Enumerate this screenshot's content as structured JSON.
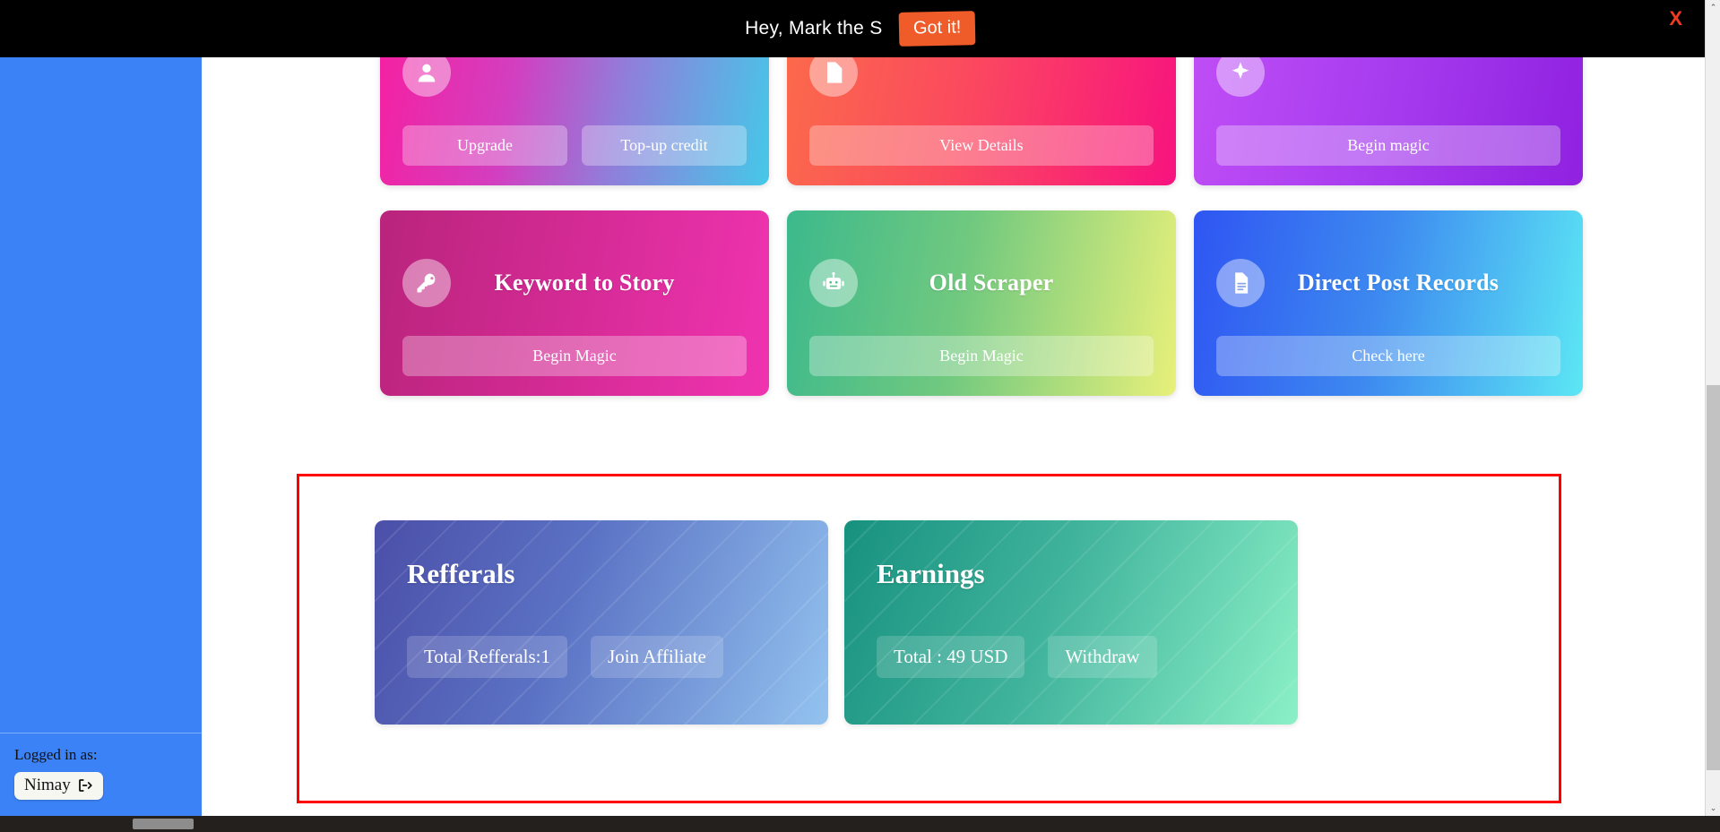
{
  "banner": {
    "message": "Hey, Mark the S",
    "cta_label": "Got it!",
    "close_label": "X",
    "background_color": "#000000",
    "cta_color": "#ef5b29",
    "close_color": "#ef3b20"
  },
  "sidebar": {
    "background_color": "#3b82f6",
    "logged_in_label": "Logged in as:",
    "username": "Nimay",
    "logout_icon": "logout-icon"
  },
  "feature_cards": [
    {
      "title": "",
      "icon": "user-circle-icon",
      "gradient_class": "grad-pinkcyan",
      "buttons": [
        "Upgrade",
        "Top-up credit"
      ]
    },
    {
      "title": "",
      "icon": "file-icon",
      "gradient_class": "grad-orangepink",
      "buttons": [
        "View Details"
      ]
    },
    {
      "title": "",
      "icon": "sparkle-icon",
      "gradient_class": "grad-purple",
      "buttons": [
        "Begin magic"
      ]
    },
    {
      "title": "Keyword to Story",
      "icon": "key-icon",
      "gradient_class": "grad-magenta",
      "buttons": [
        "Begin Magic"
      ]
    },
    {
      "title": "Old Scraper",
      "icon": "robot-icon",
      "gradient_class": "grad-greenlime",
      "buttons": [
        "Begin Magic"
      ]
    },
    {
      "title": "Direct Post Records",
      "icon": "document-icon",
      "gradient_class": "grad-bluecyan",
      "buttons": [
        "Check here"
      ]
    }
  ],
  "highlight": {
    "border_color": "#ff0000"
  },
  "stats": [
    {
      "title": "Refferals",
      "gradient_class": "stat-blue",
      "primary_label": "Total Refferals:1",
      "action_label": "Join Affiliate"
    },
    {
      "title": "Earnings",
      "gradient_class": "stat-green",
      "primary_label": "Total : 49 USD",
      "action_label": "Withdraw"
    }
  ],
  "scrollbars": {
    "vertical_up_arrow": "⌃",
    "vertical_down_arrow": "⌄"
  }
}
